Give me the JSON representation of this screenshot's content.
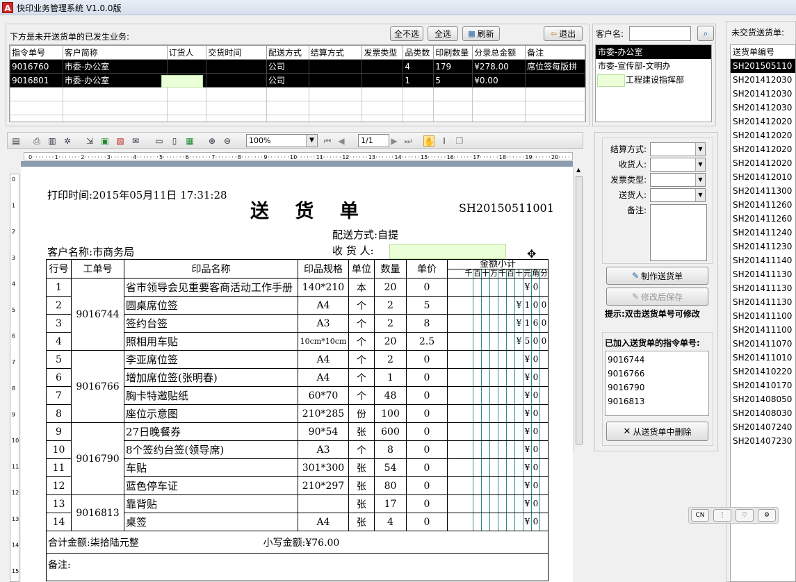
{
  "window": {
    "title": "快印业务管理系统 V1.0.0版",
    "icon": "A"
  },
  "top_panel": {
    "caption": "下方是未开送货单的已发生业务:",
    "buttons": {
      "select_none": "全不选",
      "select_all": "全选",
      "refresh": "刷新",
      "exit": "退出"
    },
    "columns": [
      "指令单号",
      "客户简称",
      "订货人",
      "交货时间",
      "配送方式",
      "结算方式",
      "发票类型",
      "品类数",
      "印刷数量",
      "分录总金额",
      "备注"
    ],
    "rows": [
      [
        "9016760",
        "市委-办公室",
        "",
        "",
        "公司",
        "",
        "",
        "4",
        "179",
        "¥278.00",
        "席位签每版拼"
      ],
      [
        "9016801",
        "市委-办公室",
        "",
        "",
        "公司",
        "",
        "",
        "1",
        "5",
        "¥0.00",
        ""
      ]
    ]
  },
  "customer_panel": {
    "label": "客户名:",
    "input_value": "",
    "items": [
      "市委-办公室",
      "市委-宣传部-文明办",
      "工程建设指挥部"
    ]
  },
  "pending_panel": {
    "label": "未交货送货单:",
    "column": "送货单编号",
    "items": [
      "SH201505110",
      "SH201412030",
      "SH201412030",
      "SH201412030",
      "SH201412020",
      "SH201412020",
      "SH201412020",
      "SH201412020",
      "SH201412010",
      "SH201411300",
      "SH201411260",
      "SH201411260",
      "SH201411240",
      "SH201411230",
      "SH201411140",
      "SH201411130",
      "SH201411130",
      "SH201411130",
      "SH201411100",
      "SH201411100",
      "SH201411070",
      "SH201411010",
      "SH201410220",
      "SH201410170",
      "SH201408050",
      "SH201408030",
      "SH201407240",
      "SH201407230"
    ]
  },
  "toolbar": {
    "zoom": "100%",
    "page": "1/1"
  },
  "document": {
    "print_time_label": "打印时间:",
    "print_time": "2015年05月11日 17:31:28",
    "title": "送 货 单",
    "doc_no": "SH20150511001",
    "delivery_label": "配送方式:",
    "delivery_value": "自提",
    "customer_label": "客户名称:",
    "customer_value": "市商务局",
    "receiver_label": "收 货 人:",
    "headers": {
      "row_no": "行号",
      "job_no": "工单号",
      "product": "印品名称",
      "spec": "印品规格",
      "unit": "单位",
      "qty": "数量",
      "price": "单价",
      "amount": "金额小计"
    },
    "amount_units": [
      "千",
      "百",
      "十",
      "万",
      "千",
      "百",
      "十",
      "元",
      "角",
      "分"
    ],
    "groups": [
      {
        "job": "9016744",
        "items": [
          {
            "no": "1",
            "name": "省市领导会见重要客商活动工作手册",
            "spec": "140*210",
            "unit": "本",
            "qty": "20",
            "price": "0",
            "amount": [
              "",
              "",
              "",
              "",
              "",
              "",
              "",
              "¥",
              "0",
              ""
            ]
          },
          {
            "no": "2",
            "name": "圆桌席位签",
            "spec": "A4",
            "unit": "个",
            "qty": "2",
            "price": "5",
            "amount": [
              "",
              "",
              "",
              "",
              "",
              "",
              "¥",
              "1",
              "0",
              "0"
            ]
          },
          {
            "no": "3",
            "name": "签约台签",
            "spec": "A3",
            "unit": "个",
            "qty": "2",
            "price": "8",
            "amount": [
              "",
              "",
              "",
              "",
              "",
              "",
              "¥",
              "1",
              "6",
              "0"
            ]
          },
          {
            "no": "4",
            "name": "照相用车贴",
            "spec": "10cm*10cm",
            "unit": "个",
            "qty": "20",
            "price": "2.5",
            "amount": [
              "",
              "",
              "",
              "",
              "",
              "",
              "¥",
              "5",
              "0",
              "0"
            ]
          }
        ]
      },
      {
        "job": "9016766",
        "items": [
          {
            "no": "5",
            "name": "李亚席位签",
            "spec": "A4",
            "unit": "个",
            "qty": "2",
            "price": "0",
            "amount": [
              "",
              "",
              "",
              "",
              "",
              "",
              "",
              "¥",
              "0",
              ""
            ]
          },
          {
            "no": "6",
            "name": "增加席位签(张明春)",
            "spec": "A4",
            "unit": "个",
            "qty": "1",
            "price": "0",
            "amount": [
              "",
              "",
              "",
              "",
              "",
              "",
              "",
              "¥",
              "0",
              ""
            ]
          },
          {
            "no": "7",
            "name": "胸卡特邀贴纸",
            "spec": "60*70",
            "unit": "个",
            "qty": "48",
            "price": "0",
            "amount": [
              "",
              "",
              "",
              "",
              "",
              "",
              "",
              "¥",
              "0",
              ""
            ]
          },
          {
            "no": "8",
            "name": "座位示意图",
            "spec": "210*285",
            "unit": "份",
            "qty": "100",
            "price": "0",
            "amount": [
              "",
              "",
              "",
              "",
              "",
              "",
              "",
              "¥",
              "0",
              ""
            ]
          }
        ]
      },
      {
        "job": "9016790",
        "items": [
          {
            "no": "9",
            "name": "27日晚餐券",
            "spec": "90*54",
            "unit": "张",
            "qty": "600",
            "price": "0",
            "amount": [
              "",
              "",
              "",
              "",
              "",
              "",
              "",
              "¥",
              "0",
              ""
            ]
          },
          {
            "no": "10",
            "name": "8个签约台签(领导席)",
            "spec": "A3",
            "unit": "个",
            "qty": "8",
            "price": "0",
            "amount": [
              "",
              "",
              "",
              "",
              "",
              "",
              "",
              "¥",
              "0",
              ""
            ]
          },
          {
            "no": "11",
            "name": "车贴",
            "spec": "301*300",
            "unit": "张",
            "qty": "54",
            "price": "0",
            "amount": [
              "",
              "",
              "",
              "",
              "",
              "",
              "",
              "¥",
              "0",
              ""
            ]
          },
          {
            "no": "12",
            "name": "蓝色停车证",
            "spec": "210*297",
            "unit": "张",
            "qty": "80",
            "price": "0",
            "amount": [
              "",
              "",
              "",
              "",
              "",
              "",
              "",
              "¥",
              "0",
              ""
            ]
          }
        ]
      },
      {
        "job": "9016813",
        "items": [
          {
            "no": "13",
            "name": "靠背贴",
            "spec": "",
            "unit": "张",
            "qty": "17",
            "price": "0",
            "amount": [
              "",
              "",
              "",
              "",
              "",
              "",
              "",
              "¥",
              "0",
              ""
            ]
          },
          {
            "no": "14",
            "name": "桌签",
            "spec": "A4",
            "unit": "张",
            "qty": "4",
            "price": "0",
            "amount": [
              "",
              "",
              "",
              "",
              "",
              "",
              "",
              "¥",
              "0",
              ""
            ]
          }
        ]
      }
    ],
    "total_label": "合计金额:",
    "total_words": "柒拾陆元整",
    "total_num_label": "小写金额:",
    "total_num": "¥76.00",
    "remark_label": "备注:"
  },
  "right_form": {
    "settlement_label": "结算方式:",
    "receiver_label": "收货人:",
    "invoice_label": "发票类型:",
    "sender_label": "送货人:",
    "remark_label": "备注:",
    "make_button": "制作送货单",
    "save_button": "修改后保存",
    "hint": "提示:双击送货单号可修改",
    "added_label": "已加入送货单的指令单号:",
    "added_items": [
      "9016744",
      "9016766",
      "9016790",
      "9016813"
    ],
    "delete_button": "从送货单中删除"
  },
  "floatbar": {
    "lang": "CN"
  }
}
